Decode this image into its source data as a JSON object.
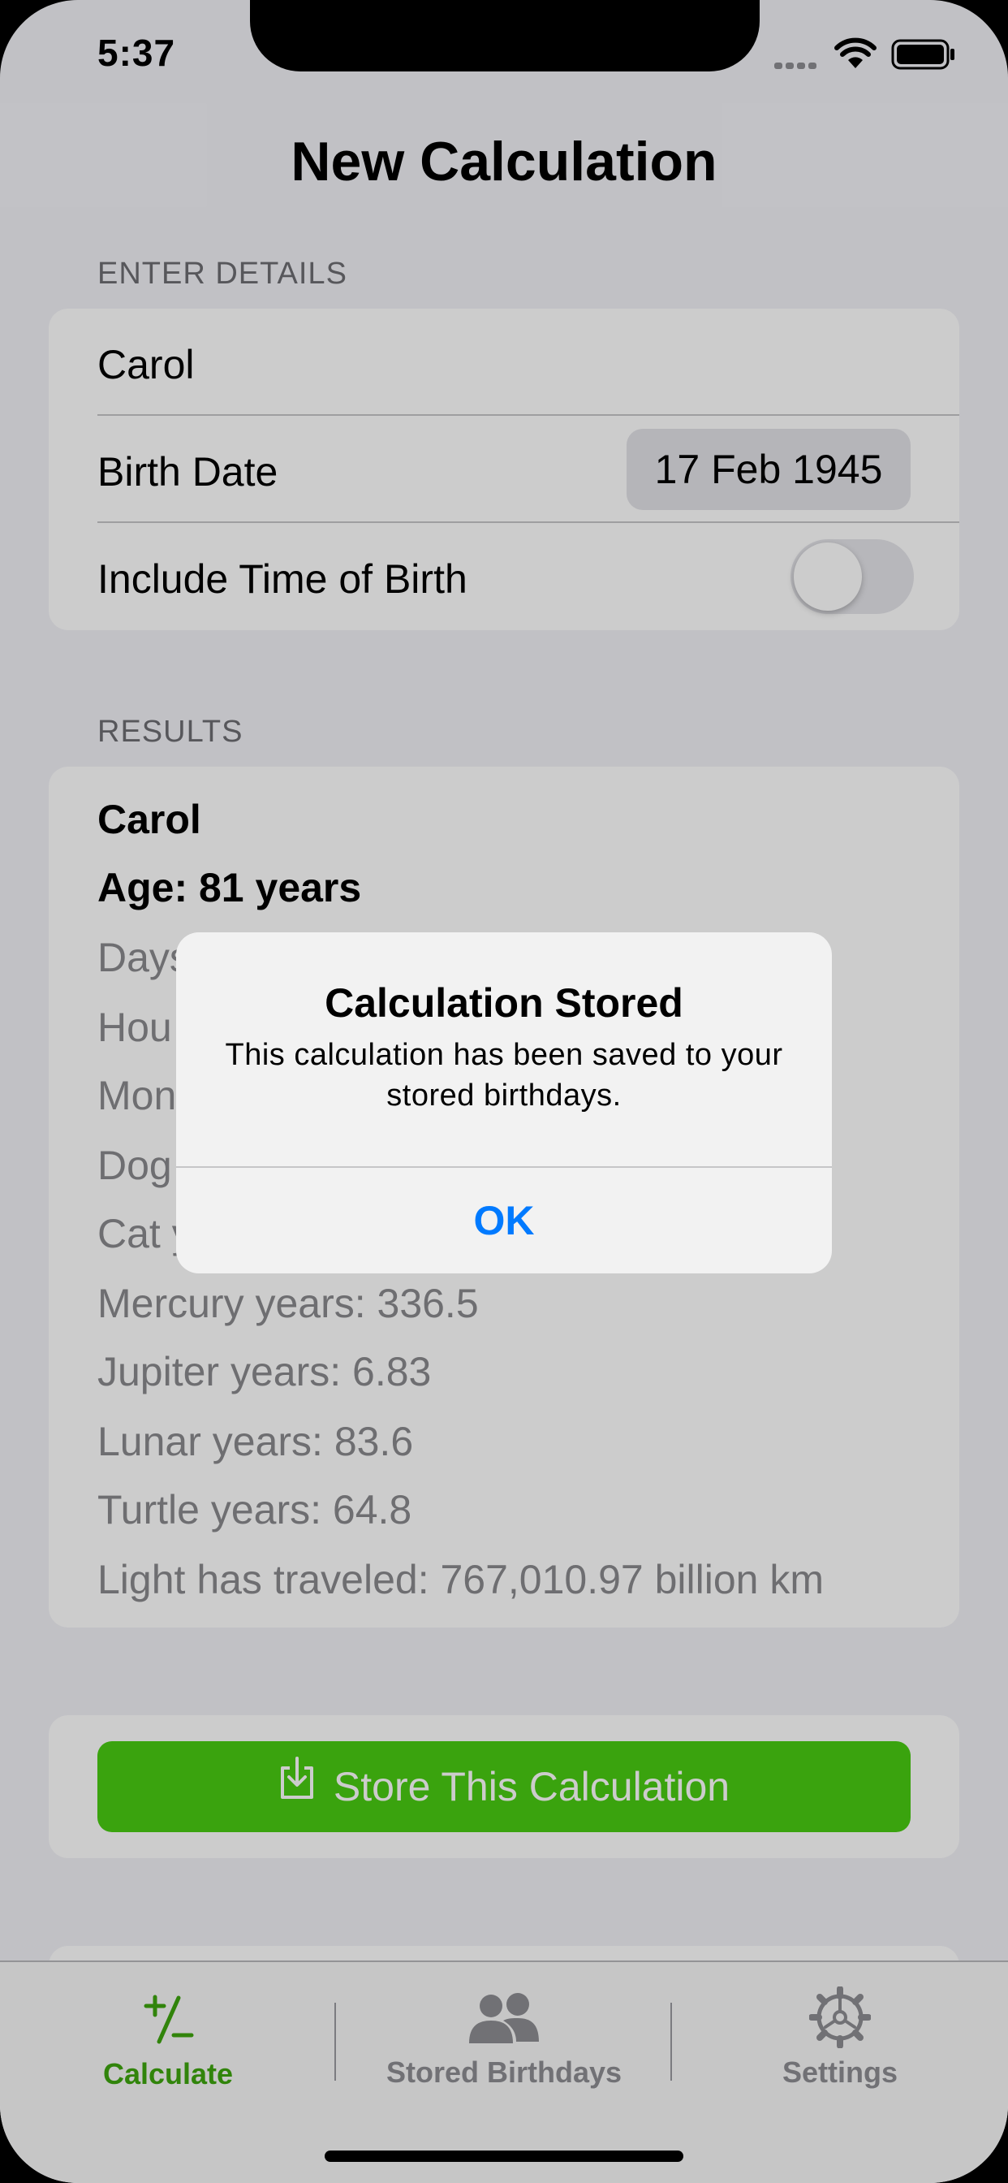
{
  "status_bar": {
    "time": "5:37"
  },
  "page": {
    "title": "New Calculation"
  },
  "details": {
    "header": "ENTER DETAILS",
    "name_value": "Carol",
    "birth_date_label": "Birth Date",
    "birth_date_value": "17 Feb 1945",
    "include_time_label": "Include Time of Birth",
    "include_time_on": false
  },
  "results": {
    "header": "RESULTS",
    "name": "Carol",
    "age": "Age: 81 years",
    "partial_lines": [
      "Days",
      "Hou",
      "Mon",
      "Dog",
      "Cat y"
    ],
    "lines": [
      "Mercury years: 336.5",
      "Jupiter years: 6.83",
      "Lunar years: 83.6",
      "Turtle years: 64.8",
      "Light has traveled: 767,010.97 billion km"
    ]
  },
  "store_button": {
    "label": "Store This Calculation",
    "icon": "download-tray-icon"
  },
  "tabs": [
    {
      "label": "Calculate",
      "icon": "plus-minus-icon",
      "active": true
    },
    {
      "label": "Stored Birthdays",
      "icon": "people-icon",
      "active": false
    },
    {
      "label": "Settings",
      "icon": "gear-icon",
      "active": false
    }
  ],
  "alert": {
    "title": "Calculation Stored",
    "message": "This calculation has been saved to your stored birthdays.",
    "ok_label": "OK"
  },
  "colors": {
    "accent_green": "#49cc12",
    "tab_active": "#3ea60e",
    "tab_inactive": "#8e8e93",
    "link_blue": "#007aff"
  }
}
